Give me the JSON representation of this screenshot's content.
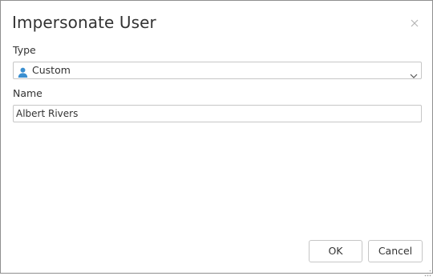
{
  "dialog": {
    "title": "Impersonate User"
  },
  "type_field": {
    "label": "Type",
    "selected_value": "Custom",
    "selected_icon": "user-icon"
  },
  "name_field": {
    "label": "Name",
    "value": "Albert Rivers"
  },
  "buttons": {
    "ok_label": "OK",
    "cancel_label": "Cancel"
  },
  "colors": {
    "user_icon": "#3b8fd0",
    "border": "#c6c6c6",
    "dialog_border": "#8f8f8f",
    "text": "#333333"
  }
}
